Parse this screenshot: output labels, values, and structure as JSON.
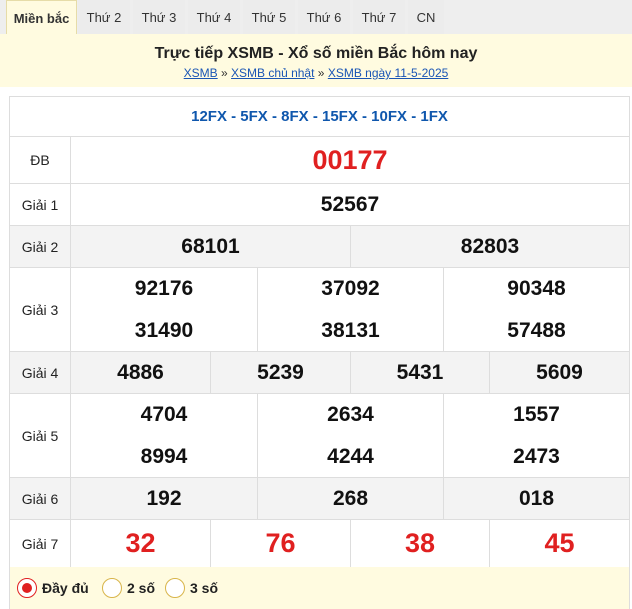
{
  "tabs": [
    {
      "label": "Miền bắc",
      "active": true
    },
    {
      "label": "Thứ 2"
    },
    {
      "label": "Thứ 3"
    },
    {
      "label": "Thứ 4"
    },
    {
      "label": "Thứ 5"
    },
    {
      "label": "Thứ 6"
    },
    {
      "label": "Thứ 7"
    },
    {
      "label": "CN"
    }
  ],
  "header": {
    "title": "Trực tiếp XSMB - Xổ số miền Bắc hôm nay",
    "crumbs": [
      "XSMB",
      "XSMB chủ nhật",
      "XSMB ngày 11-5-2025"
    ],
    "separator": "»"
  },
  "codes": "12FX - 5FX - 8FX - 15FX - 10FX - 1FX",
  "prizes": {
    "db": {
      "label": "ĐB",
      "numbers": [
        "00177"
      ]
    },
    "g1": {
      "label": "Giải 1",
      "numbers": [
        "52567"
      ]
    },
    "g2": {
      "label": "Giải 2",
      "numbers": [
        "68101",
        "82803"
      ]
    },
    "g3": {
      "label": "Giải 3",
      "numbers": [
        "92176",
        "37092",
        "90348",
        "31490",
        "38131",
        "57488"
      ]
    },
    "g4": {
      "label": "Giải 4",
      "numbers": [
        "4886",
        "5239",
        "5431",
        "5609"
      ]
    },
    "g5": {
      "label": "Giải 5",
      "numbers": [
        "4704",
        "2634",
        "1557",
        "8994",
        "4244",
        "2473"
      ]
    },
    "g6": {
      "label": "Giải 6",
      "numbers": [
        "192",
        "268",
        "018"
      ]
    },
    "g7": {
      "label": "Giải 7",
      "numbers": [
        "32",
        "76",
        "38",
        "45"
      ]
    }
  },
  "options": [
    {
      "label": "Đầy đủ",
      "selected": true
    },
    {
      "label": "2 số",
      "selected": false
    },
    {
      "label": "3 số",
      "selected": false
    }
  ],
  "colors": {
    "accent_red": "#e02020",
    "code_blue": "#0f57ad",
    "link_blue": "#1a55b5",
    "header_bg": "#fffbe0"
  }
}
